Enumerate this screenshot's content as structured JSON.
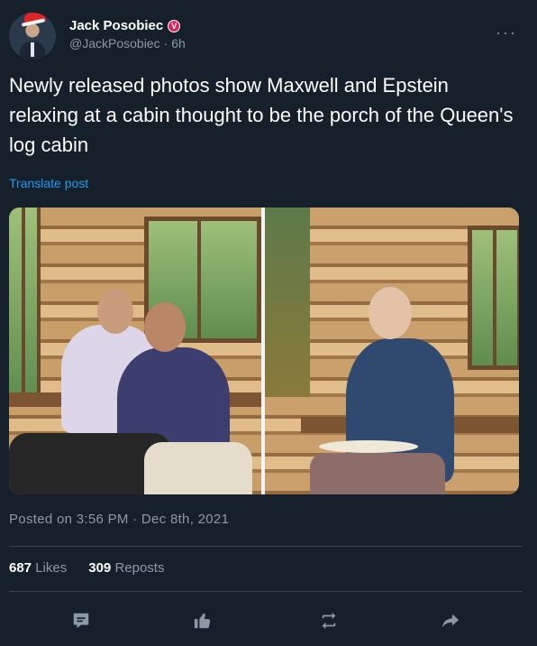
{
  "author": {
    "display_name": "Jack Posobiec",
    "badge_letter": "V",
    "handle": "@JackPosobiec",
    "separator": "·",
    "age": "6h"
  },
  "tweet": {
    "text": "Newly released photos show Maxwell and Epstein relaxing at a cabin thought to be the porch of the Queen's log cabin",
    "translate_label": "Translate post"
  },
  "timestamp": "Posted on 3:56 PM · Dec 8th, 2021",
  "stats": {
    "likes_count": "687",
    "likes_label": "Likes",
    "reposts_count": "309",
    "reposts_label": "Reposts"
  },
  "icons": {
    "more": "more-icon",
    "reply": "reply-icon",
    "like": "like-icon",
    "repost": "repost-icon",
    "share": "share-icon"
  },
  "colors": {
    "background": "#15202b",
    "secondary_text": "#8b98a5",
    "link": "#1d9bf0",
    "badge": "#e0245e"
  }
}
